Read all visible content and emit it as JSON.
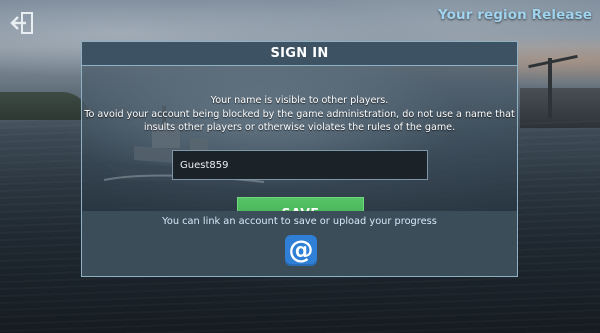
{
  "header": {
    "region_label": "Your region Release",
    "back_icon": "exit-arrow-icon"
  },
  "dialog": {
    "title": "SIGN IN",
    "info_lines": [
      "Your name is visible to other players.",
      "To avoid your account being blocked by the game administration, do not use a name that",
      "insults other players or otherwise violates the rules of the game."
    ],
    "name_input": {
      "value": "Guest859",
      "placeholder": ""
    },
    "save_label": "SAVE",
    "link_text": "You can link an account to save or upload your progress",
    "link_icon": "at-sign-icon"
  },
  "colors": {
    "accent_blue": "#9fd3ee",
    "save_green": "#4bb85c",
    "at_button_blue": "#2f7fd6",
    "dialog_border": "#8fb1c6"
  }
}
